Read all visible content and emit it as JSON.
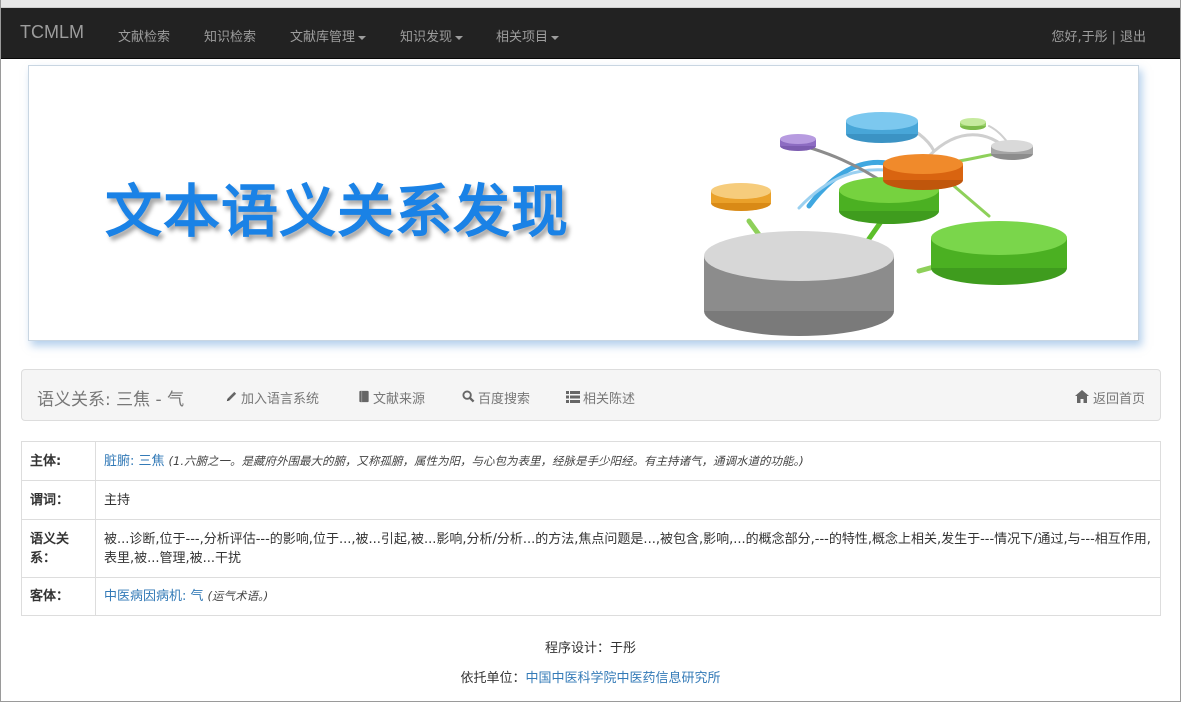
{
  "nav": {
    "brand": "TCMLM",
    "items": [
      {
        "label": "文献检索",
        "dropdown": false
      },
      {
        "label": "知识检索",
        "dropdown": false
      },
      {
        "label": "文献库管理",
        "dropdown": true
      },
      {
        "label": "知识发现",
        "dropdown": true
      },
      {
        "label": "相关项目",
        "dropdown": true
      }
    ],
    "greeting": "您好,于彤",
    "separator": "|",
    "logout": "退出"
  },
  "banner": {
    "title": "文本语义关系发现"
  },
  "bar": {
    "title": "语义关系:  三焦 - 气",
    "actions": [
      {
        "label": "加入语言系统",
        "icon": "pencil-icon"
      },
      {
        "label": "文献来源",
        "icon": "book-icon"
      },
      {
        "label": "百度搜索",
        "icon": "search-icon"
      },
      {
        "label": "相关陈述",
        "icon": "list-icon"
      }
    ],
    "home": {
      "label": "返回首页",
      "icon": "home-icon"
    }
  },
  "table": {
    "subject": {
      "label": "主体:",
      "link": "脏腑: 三焦",
      "note": "(1.六腑之一。是藏府外围最大的腑，又称孤腑，属性为阳，与心包为表里，经脉是手少阳经。有主持诸气，通调水道的功能。)"
    },
    "predicate": {
      "label": "谓词：",
      "value": "主持"
    },
    "relation": {
      "label": "语义关系：",
      "value": "被...诊断,位于---,分析评估---的影响,位于...,被...引起,被...影响,分析/分析...的方法,焦点问题是...,被包含,影响,...的概念部分,---的特性,概念上相关,发生于---情况下/通过,与---相互作用,表里,被...管理,被...干扰"
    },
    "object": {
      "label": "客体：",
      "link": "中医病因病机: 气",
      "note": "(运气术语。)"
    }
  },
  "footer": {
    "designer_prefix": "程序设计：",
    "designer": "于彤",
    "org_prefix": "依托单位：",
    "org": "中国中医科学院中医药信息研究所"
  },
  "colors": {
    "navbar_bg": "#222222",
    "nav_text": "#9d9d9d",
    "link": "#337ab7",
    "banner_title": "#1a82e6"
  }
}
